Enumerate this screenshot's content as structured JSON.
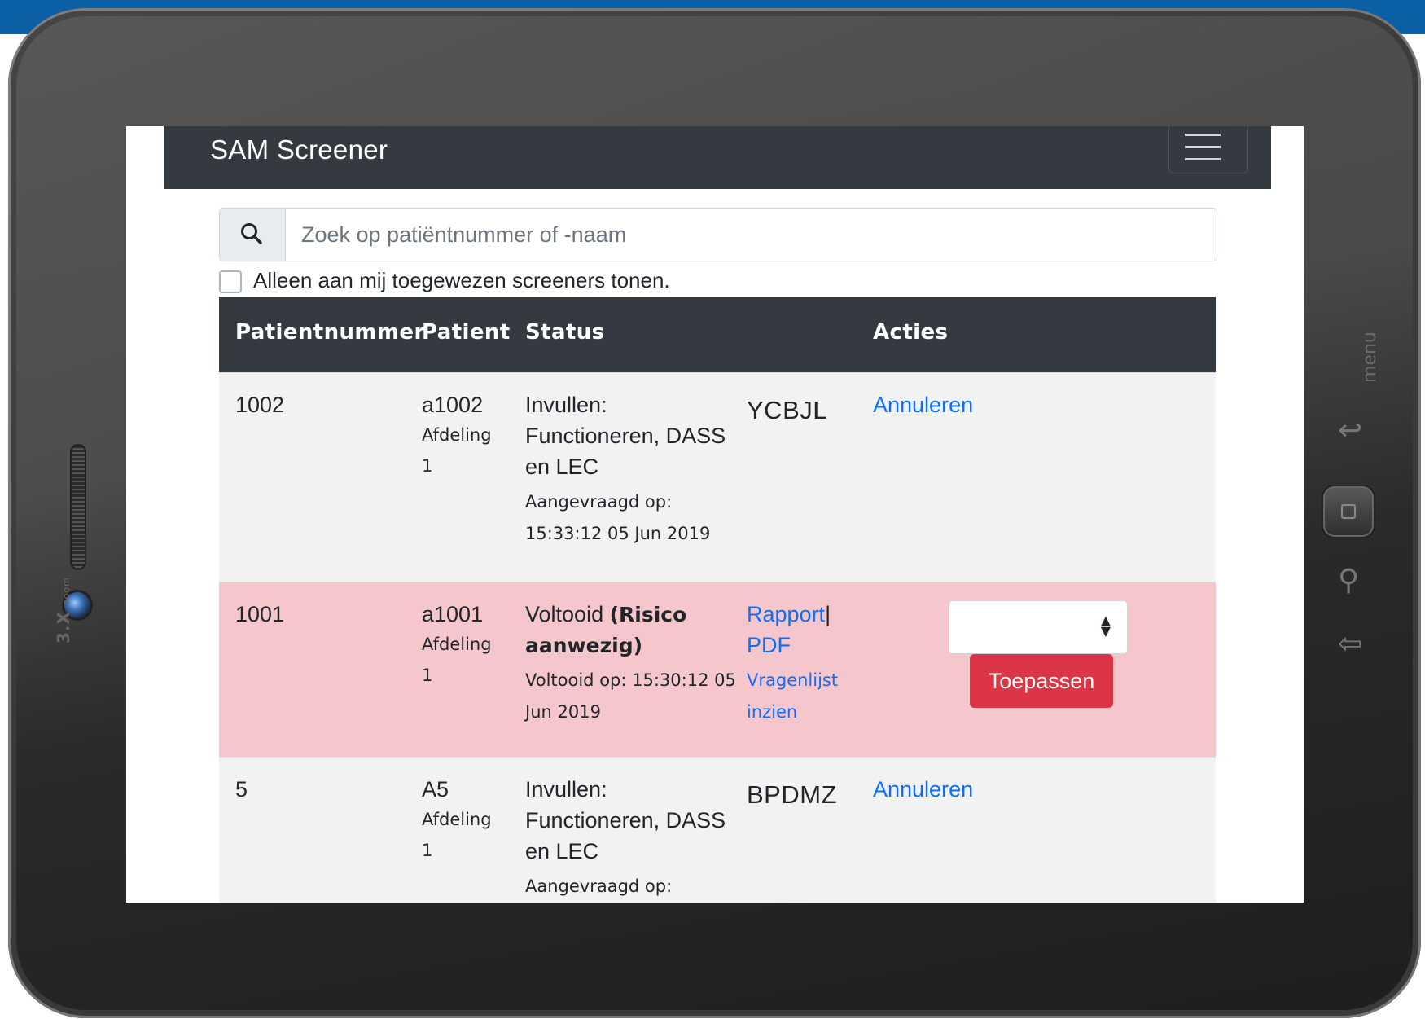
{
  "device": {
    "zoom_label": "3.X",
    "zoom_sublabel": "zoom",
    "menu_label": "menu"
  },
  "app": {
    "brand": "SAM Screener"
  },
  "search": {
    "placeholder": "Zoek op patiëntnummer of -naam"
  },
  "filter": {
    "label": "Alleen aan mij toegewezen screeners tonen.",
    "checked": false
  },
  "table": {
    "headers": [
      "Patientnummer",
      "Patient",
      "Status",
      "",
      "Acties"
    ],
    "rows": [
      {
        "number": "1002",
        "patient": "a1002",
        "department_line1": "Afdeling",
        "department_line2": "1",
        "status_line1": "Invullen:",
        "status_line2": "Functioneren, DASS",
        "status_line3": "en LEC",
        "status_date_line1": "Aangevraagd op:",
        "status_date_line2": "15:33:12 05 Jun 2019",
        "code": "YCBJL",
        "action": "Annuleren"
      },
      {
        "number": "1001",
        "patient": "a1001",
        "department_line1": "Afdeling",
        "department_line2": "1",
        "status_line1_plain": "Voltooid ",
        "status_line1_bold": "(Risico",
        "status_line2_bold": "aanwezig)",
        "status_date_line1": "Voltooid op: 15:30:12 05",
        "status_date_line2": "Jun 2019",
        "report_link": "Rapport",
        "separator": "|",
        "pdf_link": "PDF",
        "questionnaire_line1": "Vragenlijst",
        "questionnaire_line2": "inzien",
        "select_value": "",
        "apply_button": "Toepassen"
      },
      {
        "number": "5",
        "patient": "A5",
        "department_line1": "Afdeling",
        "department_line2": "1",
        "status_line1": "Invullen:",
        "status_line2": "Functioneren, DASS",
        "status_line3": "en LEC",
        "status_date_line1": "Aangevraagd op:",
        "code": "BPDMZ",
        "action": "Annuleren"
      }
    ]
  }
}
